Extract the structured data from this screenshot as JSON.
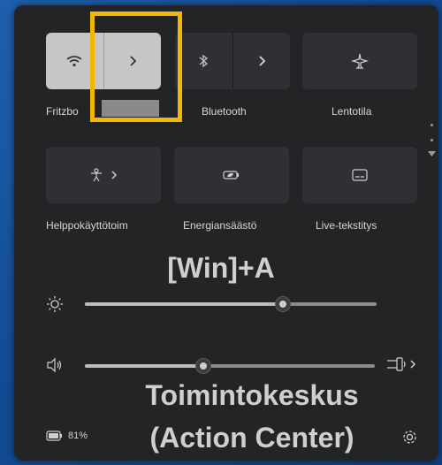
{
  "tiles_row1": {
    "wifi_label": "Fritzbo",
    "bluetooth_label": "Bluetooth",
    "airplane_label": "Lentotila"
  },
  "tiles_row2": {
    "accessibility_label": "Helppokäyttötoim",
    "energy_label": "Energiansäästö",
    "captions_label": "Live-tekstitys"
  },
  "overlay": {
    "shortcut": "[Win]+A",
    "title_line1": "Toimintokeskus",
    "title_line2": "(Action Center)"
  },
  "sliders": {
    "brightness_level": 0.68,
    "volume_level": 0.41
  },
  "footer": {
    "battery_text": "81%"
  },
  "colors": {
    "highlight": "#f5b800",
    "panel": "#222426",
    "active_tile": "#c6c6c6"
  },
  "icons": [
    "wifi-icon",
    "chevron-right-icon",
    "bluetooth-icon",
    "airplane-icon",
    "accessibility-icon",
    "energy-saver-icon",
    "live-captions-icon",
    "brightness-icon",
    "volume-icon",
    "audio-output-icon",
    "battery-icon",
    "settings-icon"
  ]
}
